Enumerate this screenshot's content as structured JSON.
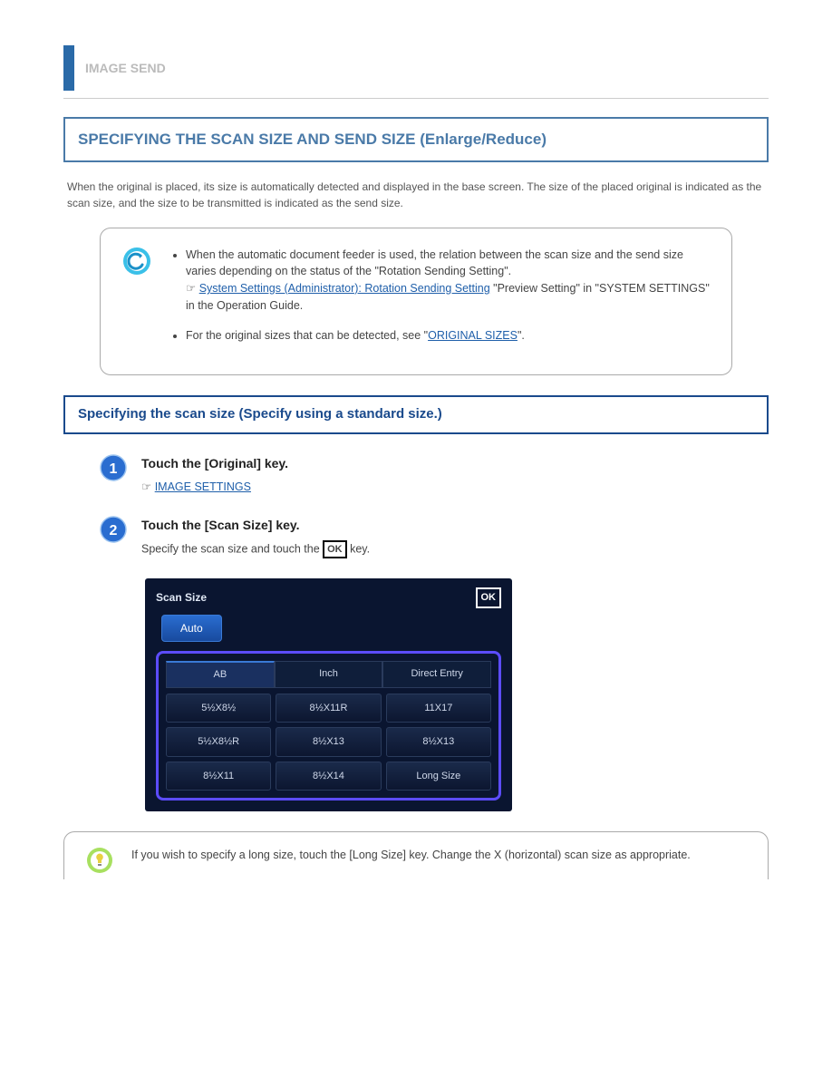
{
  "chapter": "IMAGE SEND",
  "section": {
    "title": "SPECIFYING THE SCAN SIZE AND SEND SIZE (Enlarge/Reduce)",
    "description": "When the original is placed, its size is automatically detected and displayed in the base screen. The size of the placed original is indicated as the scan size, and the size to be transmitted is indicated as the send size."
  },
  "info": {
    "items": [
      {
        "text_before": "When the automatic document feeder is used, the relation between the scan size and the send size varies depending on the status of the \"Rotation Sending Setting\".",
        "link_prefix": "☞ ",
        "link": "System Settings (Administrator): Rotation Sending Setting",
        "link_after": "\"Preview Setting\" in \"SYSTEM SETTINGS\" in the Operation Guide."
      },
      {
        "text_before": "For the original sizes that can be detected, see \"",
        "link": "ORIGINAL SIZES",
        "text_after": "\"."
      }
    ]
  },
  "subsection": "Specifying the scan size (Specify using a standard size.)",
  "steps": [
    {
      "title": "Touch the [Original] key.",
      "desc_before": "☞ ",
      "link": "IMAGE SETTINGS"
    },
    {
      "title": "Touch the [Scan Size] key.",
      "desc": "Specify the scan size and touch the ",
      "desc_after": " key."
    }
  ],
  "screenshot": {
    "title": "Scan Size",
    "ok": "OK",
    "auto": "Auto",
    "tabs": [
      "AB",
      "Inch",
      "Direct Entry"
    ],
    "grid": [
      "5½X8½",
      "8½X11R",
      "11X17",
      "5½X8½R",
      "8½X13",
      "8½X13",
      "8½X11",
      "8½X14",
      "Long Size"
    ]
  },
  "tip": {
    "text": "If you wish to specify a long size, touch the [Long Size] key. Change the X (horizontal) scan size as appropriate."
  }
}
